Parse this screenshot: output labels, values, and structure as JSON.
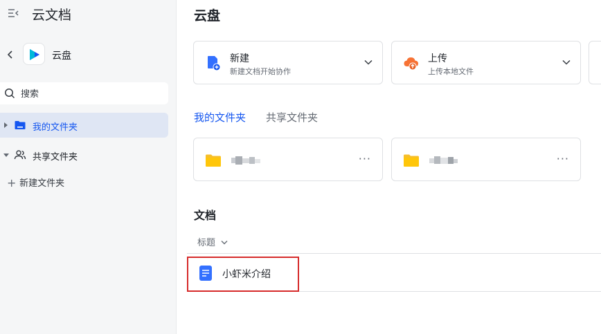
{
  "sidebar": {
    "app_title": "云文档",
    "space_name": "云盘",
    "search": {
      "placeholder": "搜索",
      "value": ""
    },
    "tree": [
      {
        "label": "我的文件夹",
        "active": true
      },
      {
        "label": "共享文件夹",
        "active": false
      }
    ],
    "new_folder_label": "新建文件夹"
  },
  "main": {
    "title": "云盘",
    "action_cards": [
      {
        "title": "新建",
        "subtitle": "新建文档开始协作",
        "icon": "new-doc-icon"
      },
      {
        "title": "上传",
        "subtitle": "上传本地文件",
        "icon": "upload-cloud-icon"
      }
    ],
    "folder_tabs": [
      {
        "label": "我的文件夹",
        "active": true
      },
      {
        "label": "共享文件夹",
        "active": false
      }
    ],
    "folder_more_label": "···",
    "documents_section_title": "文档",
    "sort_label": "标题",
    "documents": [
      {
        "name": "小虾米介绍",
        "icon": "doc-icon"
      }
    ]
  },
  "colors": {
    "accent": "#1456f0",
    "folder_yellow": "#f7bf2a",
    "upload_orange": "#f77234",
    "highlight_red": "#d62a2a"
  }
}
